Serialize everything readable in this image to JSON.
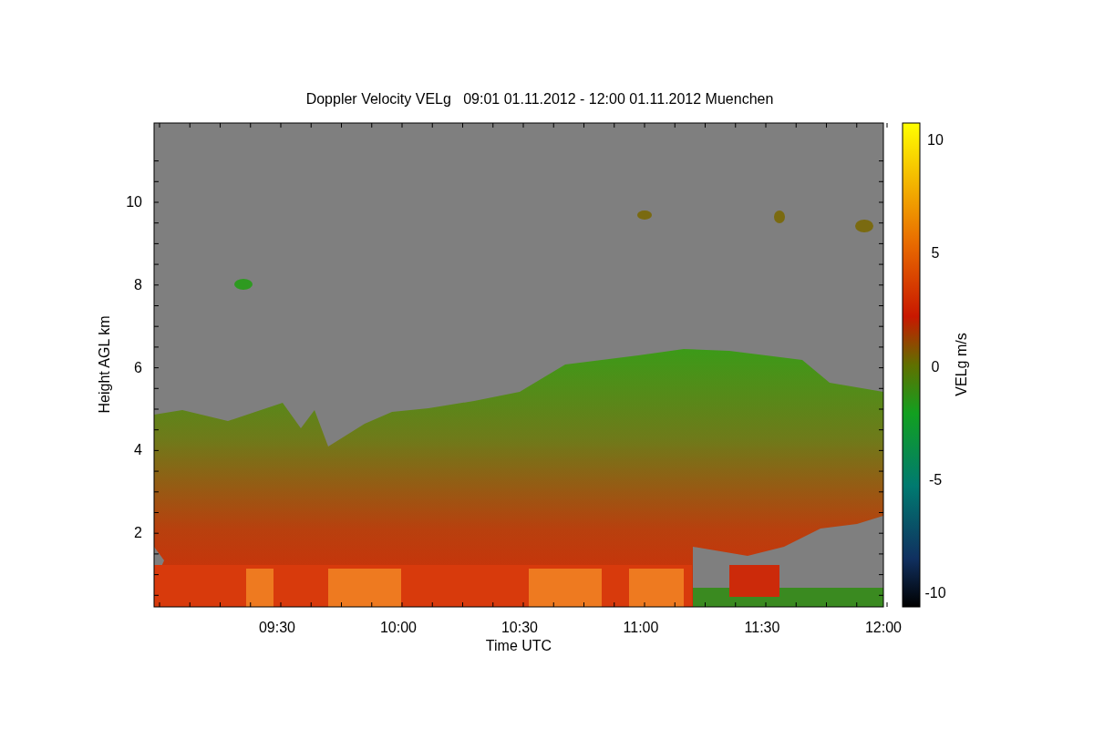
{
  "title": "Doppler Velocity VELg   09:01 01.11.2012 - 12:00 01.11.2012 Muenchen",
  "x_axis": {
    "label": "Time UTC",
    "ticks": [
      "09:30",
      "10:00",
      "10:30",
      "11:00",
      "11:30",
      "12:00"
    ]
  },
  "y_axis": {
    "label": "Height AGL km",
    "ticks": [
      "10",
      "8",
      "6",
      "4",
      "2"
    ]
  },
  "colorbar": {
    "label": "VELg m/s",
    "ticks": [
      "10",
      "5",
      "0",
      "-5",
      "-10"
    ]
  }
}
